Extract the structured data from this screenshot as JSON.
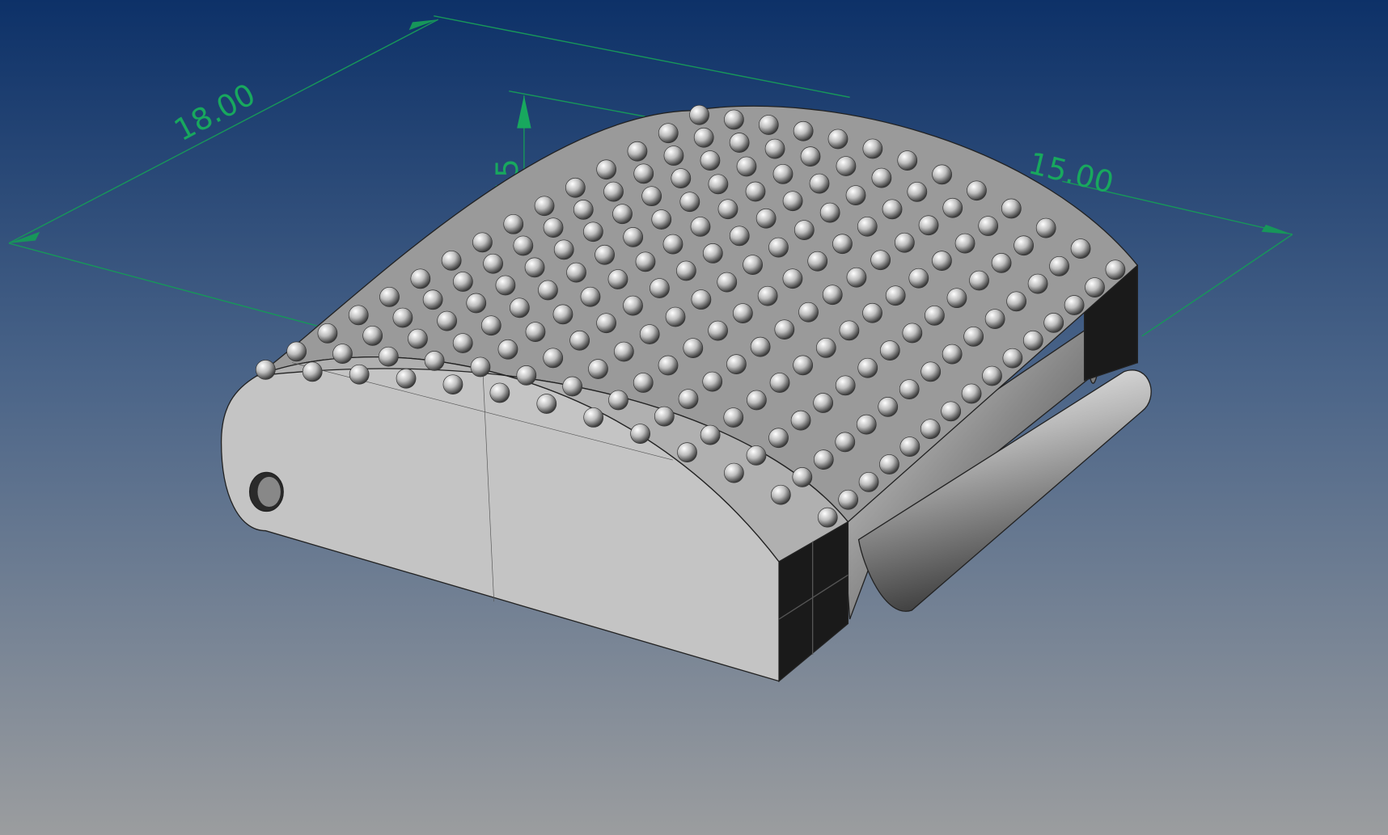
{
  "viewport": {
    "background_top": "#0d3168",
    "background_bottom": "#9b9d9f",
    "dimension_color": "#18a85e",
    "model_color": "#c2c2c2"
  },
  "dimensions": {
    "length": "18.00",
    "height": "5.15",
    "width": "15.00"
  }
}
